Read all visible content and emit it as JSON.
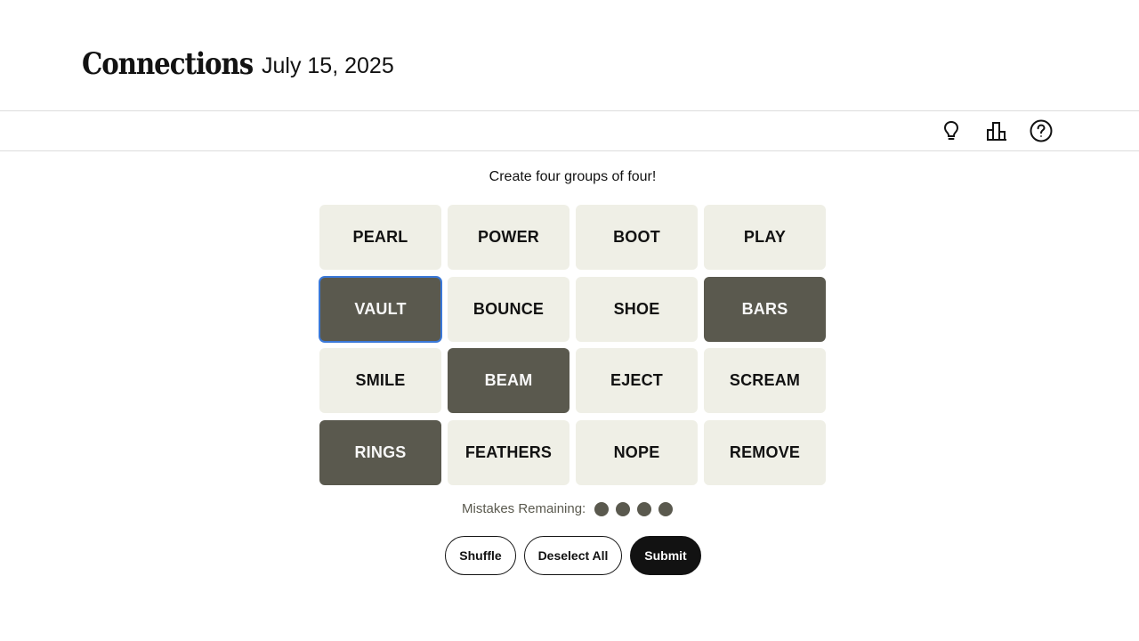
{
  "header": {
    "title": "Connections",
    "date": "July 15, 2025"
  },
  "toolbar": {
    "icons": [
      "lightbulb-icon",
      "leaderboard-icon",
      "help-icon"
    ]
  },
  "game": {
    "instructions": "Create four groups of four!",
    "tiles": [
      {
        "word": "PEARL",
        "selected": false
      },
      {
        "word": "POWER",
        "selected": false
      },
      {
        "word": "BOOT",
        "selected": false
      },
      {
        "word": "PLAY",
        "selected": false
      },
      {
        "word": "VAULT",
        "selected": true,
        "focused": true
      },
      {
        "word": "BOUNCE",
        "selected": false
      },
      {
        "word": "SHOE",
        "selected": false
      },
      {
        "word": "BARS",
        "selected": true
      },
      {
        "word": "SMILE",
        "selected": false
      },
      {
        "word": "BEAM",
        "selected": true
      },
      {
        "word": "EJECT",
        "selected": false
      },
      {
        "word": "SCREAM",
        "selected": false
      },
      {
        "word": "RINGS",
        "selected": true
      },
      {
        "word": "FEATHERS",
        "selected": false
      },
      {
        "word": "NOPE",
        "selected": false
      },
      {
        "word": "REMOVE",
        "selected": false
      }
    ],
    "mistakes_label": "Mistakes Remaining:",
    "mistakes_remaining": 4
  },
  "controls": {
    "shuffle_label": "Shuffle",
    "deselect_label": "Deselect All",
    "submit_label": "Submit"
  },
  "colors": {
    "tile": "#efefe6",
    "tile_selected": "#5a594e",
    "focus_ring": "#3a78d8",
    "submit": "#121212"
  }
}
